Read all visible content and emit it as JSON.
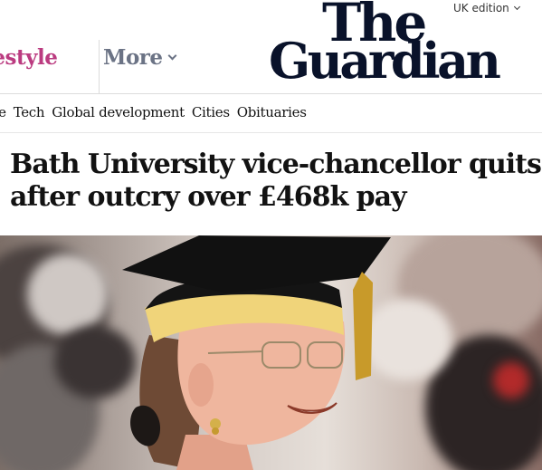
{
  "header": {
    "pillars": [
      {
        "label": "festyle",
        "color": "#bb3b80"
      },
      {
        "label": "More",
        "color": "#6b7385"
      }
    ],
    "edition_label": "UK edition",
    "logo": {
      "line1": "The",
      "line2": "Guardian"
    }
  },
  "subnav": {
    "items": [
      "ce",
      "Tech",
      "Global development",
      "Cities",
      "Obituaries"
    ]
  },
  "article": {
    "headline": "Bath University vice-chancellor quits after outcry over £468k pay"
  },
  "photo": {
    "subject": "smiling woman in black mortarboard with gold tassel"
  },
  "colors": {
    "brand_navy": "#09122a",
    "lifestyle_pink": "#bb3b80",
    "nav_grey": "#6b7385"
  }
}
